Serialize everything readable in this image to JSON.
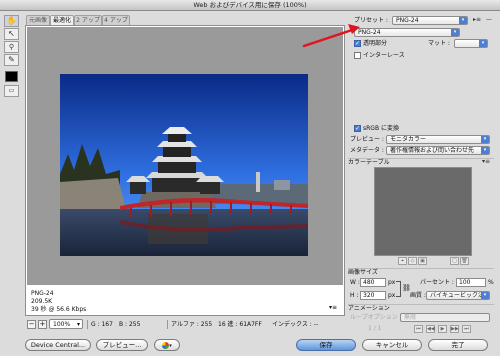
{
  "window": {
    "title": "Web およびデバイス用に保存 (100%)"
  },
  "toolbar": {
    "tools": [
      {
        "icon": "hand-icon",
        "glyph": "✋"
      },
      {
        "icon": "slice-select-icon",
        "glyph": "↖"
      },
      {
        "icon": "zoom-icon",
        "glyph": "🔍"
      },
      {
        "icon": "eyedropper-icon",
        "glyph": "✎"
      }
    ]
  },
  "tabs": [
    {
      "label": "元画像",
      "active": false
    },
    {
      "label": "最適化",
      "active": true
    },
    {
      "label": "2 アップ",
      "active": false
    },
    {
      "label": "4 アップ",
      "active": false
    }
  ],
  "preview": {
    "info_format": "PNG-24",
    "info_size": "209.5K",
    "info_time": "39 秒 @ 56.6 Kbps",
    "info_menu": "▾≡"
  },
  "statusbar": {
    "zoom": "100%",
    "g_label": "G : 167",
    "b_label": "B : 255",
    "alpha_label": "アルファ : 255",
    "hex_label": "16 進 : 61A7FF",
    "index_label": "インデックス : --"
  },
  "buttons": {
    "device_central": "Device Central...",
    "preview": "プレビュー...",
    "save": "保存",
    "cancel": "キャンセル",
    "done": "完了"
  },
  "settings": {
    "preset_label": "プリセット :",
    "preset_value": "PNG-24",
    "format_value": "PNG-24",
    "transparency_label": "透明部分",
    "transparency_checked": true,
    "matte_label": "マット :",
    "matte_value": "",
    "interlace_label": "インターレース",
    "interlace_checked": false,
    "srgb_label": "sRGB に変換",
    "srgb_checked": true,
    "preview_label": "プレビュー :",
    "preview_value": "モニタカラー",
    "metadata_label": "メタデータ :",
    "metadata_value": "著作権情報および問い合わせ先"
  },
  "colortable": {
    "title": "カラーテーブル"
  },
  "imagesize": {
    "title": "画像サイズ",
    "w_label": "W :",
    "w_value": "480",
    "h_label": "H :",
    "h_value": "320",
    "unit": "px",
    "percent_label": "パーセント :",
    "percent_value": "100",
    "percent_unit": "%",
    "quality_label": "画質 :",
    "quality_value": "バイキュービック法"
  },
  "animation": {
    "title": "アニメーション",
    "loop_label": "ループオプション :",
    "loop_value": "無限",
    "frame_counter": "1 / 1"
  },
  "colors": {
    "accent": "#4e7ed0",
    "annotation_arrow": "#e0141e",
    "sky_top": "#0b2e8a",
    "sky_bottom": "#61A7FF",
    "bridge": "#c0252a"
  }
}
